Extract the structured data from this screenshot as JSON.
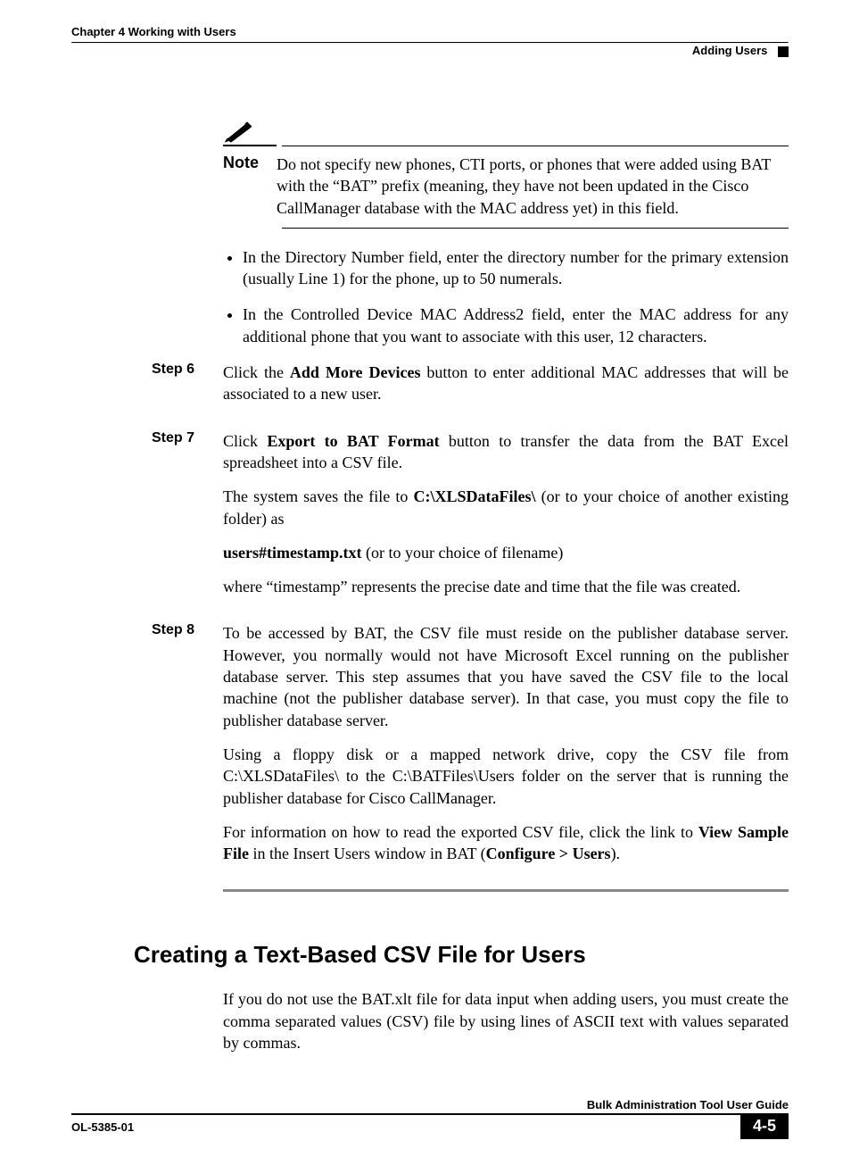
{
  "header": {
    "chapter": "Chapter 4    Working with Users",
    "section": "Adding Users"
  },
  "note": {
    "label": "Note",
    "text": "Do not specify new phones, CTI ports, or phones that were added using BAT with the “BAT” prefix (meaning, they have not been updated in the Cisco CallManager database with the MAC address yet) in this field."
  },
  "bullets": [
    "In the Directory Number field, enter the directory number for the primary extension (usually Line 1) for the phone, up to 50 numerals.",
    "In the Controlled Device MAC Address2 field, enter the MAC address for any additional phone that you want to associate with this user, 12 characters."
  ],
  "steps": {
    "step6": {
      "label": "Step 6",
      "t1a": "Click the ",
      "t1b": "Add More Devices",
      "t1c": " button to enter additional MAC addresses that will be associated to a new user."
    },
    "step7": {
      "label": "Step 7",
      "t1a": "Click ",
      "t1b": "Export to BAT Format",
      "t1c": " button to transfer the data from the BAT Excel spreadsheet into a CSV file.",
      "t2a": "The system saves the file to ",
      "t2b": "C:\\XLSDataFiles\\",
      "t2c": " (or to your choice of another existing folder) as",
      "t3a": "users#timestamp.txt",
      "t3b": " (or to your choice of filename)",
      "t4": "where “timestamp” represents the precise date and time that the file was created."
    },
    "step8": {
      "label": "Step 8",
      "t1": "To be accessed by BAT, the CSV file must reside on the publisher database server. However, you normally would not have Microsoft Excel running on the publisher database server. This step assumes that you have saved the CSV file to the local machine (not the publisher database server). In that case, you must copy the file to publisher database server.",
      "t2": "Using a floppy disk or a mapped network drive, copy the CSV file from C:\\XLSDataFiles\\ to the C:\\BATFiles\\Users folder on the server that is running the publisher database for Cisco CallManager.",
      "t3a": "For information on how to read the exported CSV file, click the link to ",
      "t3b": "View Sample File",
      "t3c": " in the Insert Users window in BAT (",
      "t3d": "Configure > Users",
      "t3e": ")."
    }
  },
  "heading": "Creating a Text-Based CSV File for Users",
  "intro": "If you do not use the BAT.xlt file for data input when adding users, you must create the comma separated values (CSV) file by using lines of ASCII text with values separated by commas.",
  "footer": {
    "guide": "Bulk Administration Tool User Guide",
    "doc": "OL-5385-01",
    "page": "4-5"
  }
}
